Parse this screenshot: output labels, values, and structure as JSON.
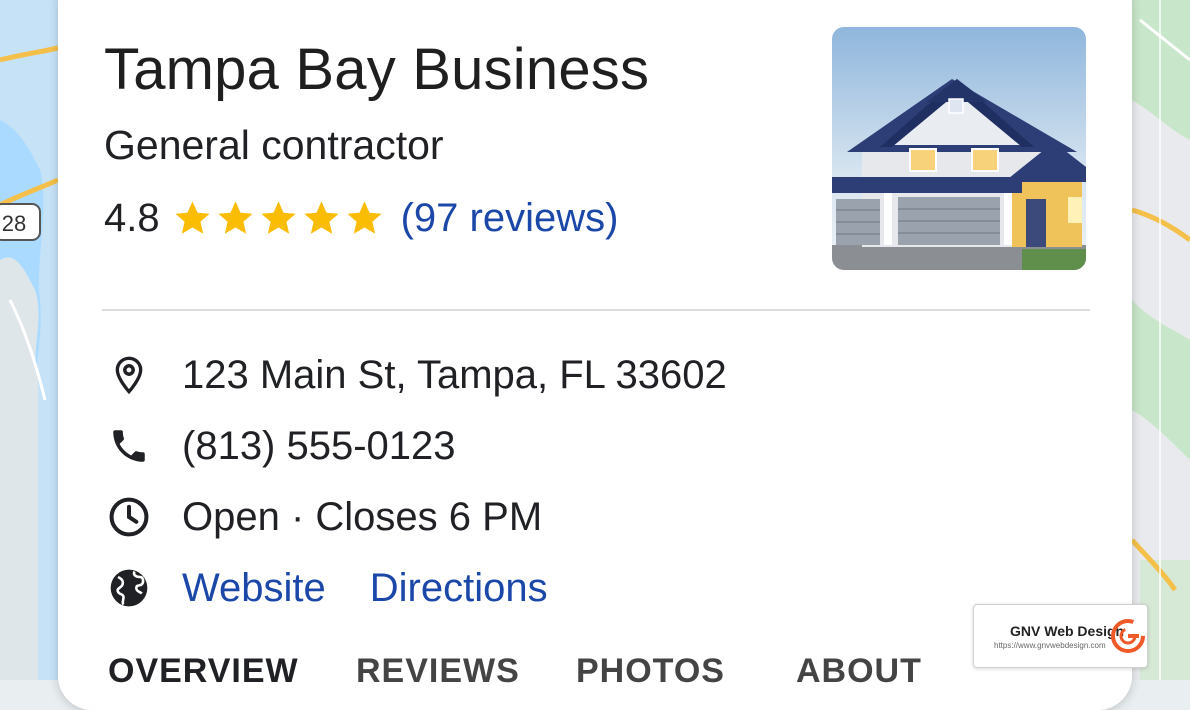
{
  "business": {
    "name": "Tampa Bay Business",
    "category": "General contractor",
    "rating": "4.8",
    "rating_value": 4.8,
    "star_count": 5,
    "reviews_link": "(97 reviews)",
    "photo_icon": "house-photo"
  },
  "details": {
    "address": "123 Main St, Tampa, FL 33602",
    "phone": "(813) 555-0123",
    "hours": "Open · Closes 6 PM",
    "website_label": "Website",
    "directions_label": "Directions"
  },
  "tabs": [
    {
      "label": "OVERVIEW",
      "active": true
    },
    {
      "label": "REVIEWS",
      "active": false
    },
    {
      "label": "PHOTOS",
      "active": false
    },
    {
      "label": "ABOUT",
      "active": false
    }
  ],
  "map": {
    "route_shield": "28"
  },
  "watermark": {
    "name": "GNV Web Design",
    "url": "https://www.gnvwebdesign.com"
  },
  "colors": {
    "link": "#1a47a8",
    "star": "#fbbc04",
    "water": "#aadaff",
    "land": "#e8eaed",
    "park": "#c8e6c9",
    "road": "#f5c04a",
    "watermark_accent": "#f05a28"
  }
}
